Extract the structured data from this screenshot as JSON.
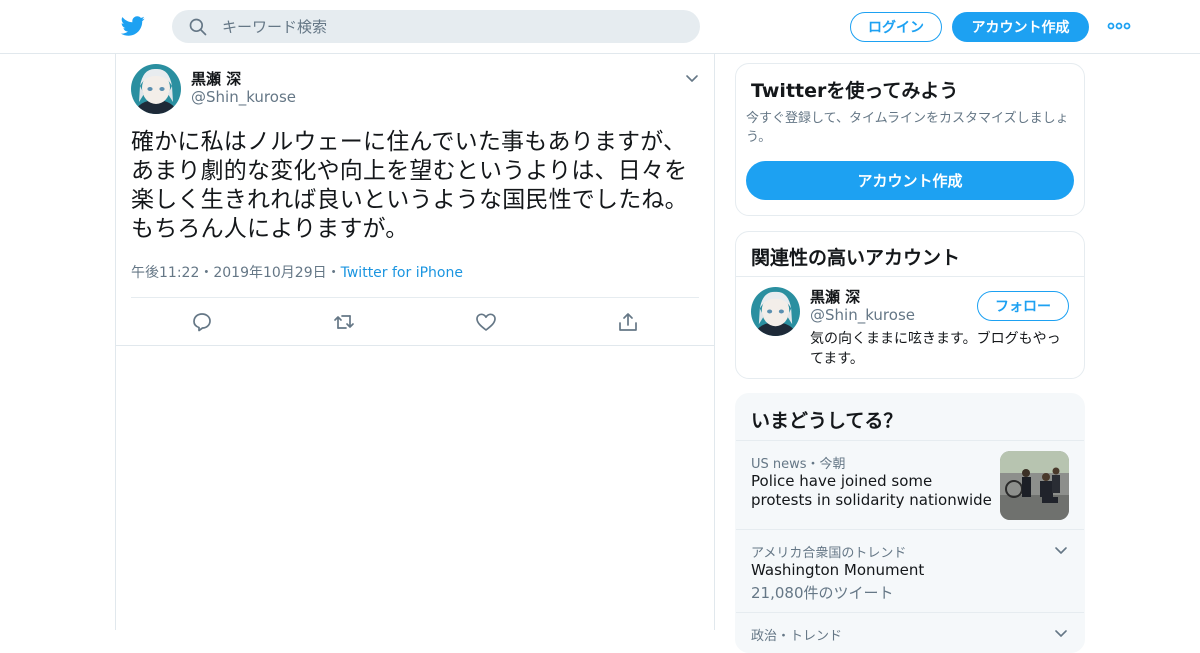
{
  "header": {
    "search_placeholder": "キーワード検索",
    "login_label": "ログイン",
    "signup_label": "アカウント作成"
  },
  "tweet": {
    "author_name": "黒瀬 深",
    "author_handle": "@Shin_kurose",
    "text": "確かに私はノルウェーに住んでいた事もありますが、あまり劇的な変化や向上を望むというよりは、日々を楽しく生きれれば良いというような国民性でしたね。もちろん人によりますが。",
    "time": "午後11:22",
    "separator": "・",
    "date": "2019年10月29日",
    "source": "Twitter for iPhone"
  },
  "signup_card": {
    "title": "Twitterを使ってみよう",
    "description": "今すぐ登録して、タイムラインをカスタマイズしましょう。",
    "button_label": "アカウント作成"
  },
  "related_card": {
    "title": "関連性の高いアカウント",
    "user_name": "黒瀬 深",
    "user_handle": "@Shin_kurose",
    "follow_label": "フォロー",
    "bio": "気の向くままに呟きます。ブログもやってます。"
  },
  "trends_card": {
    "title": "いまどうしてる？",
    "items": [
      {
        "context": "US news・今朝",
        "headline": "Police have joined some protests in solidarity nationwide"
      },
      {
        "context": "アメリカ合衆国のトレンド",
        "headline": "Washington Monument",
        "count": "21,080件のツイート"
      },
      {
        "context": "政治・トレンド"
      }
    ]
  },
  "colors": {
    "accent": "#1da1f2",
    "link": "#1b95e0",
    "secondary_text": "#657786",
    "border": "#e1e8ed"
  },
  "icons": [
    "twitter-bird-icon",
    "search-icon",
    "more-dots-icon",
    "chevron-down-icon",
    "reply-icon",
    "retweet-icon",
    "like-heart-icon",
    "share-icon"
  ]
}
